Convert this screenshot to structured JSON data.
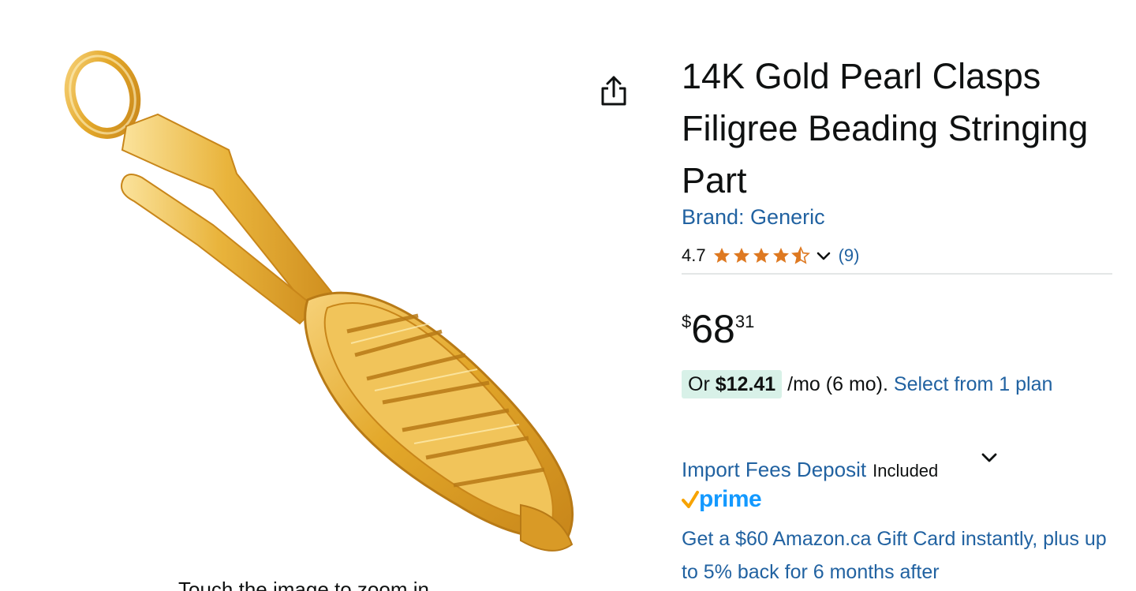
{
  "image": {
    "zoom_hint": "Touch the image to zoom in"
  },
  "share": {
    "icon": "share-icon"
  },
  "product": {
    "title": "14K Gold Pearl Clasps Filigree Beading Stringing Part",
    "brand_label": "Brand: Generic",
    "rating_value": "4.7",
    "rating_stars": 4.5,
    "review_count": "(9)",
    "price_symbol": "$",
    "price_whole": "68",
    "price_fraction": "31",
    "installment_prefix": "Or",
    "installment_amount": "$12.41",
    "installment_suffix": "/mo (6 mo).",
    "installment_link": "Select from 1 plan",
    "import_fees_link": "Import Fees Deposit",
    "import_fees_status": "Included",
    "prime_label": "prime",
    "promo_text": "Get a $60 Amazon.ca Gift Card instantly, plus up to 5% back for 6 months after"
  },
  "colors": {
    "link": "#2162a1",
    "star": "#de7921",
    "prime_check": "#f7a300",
    "prime_text": "#1399ff",
    "installment_highlight": "#d8f1e8"
  }
}
